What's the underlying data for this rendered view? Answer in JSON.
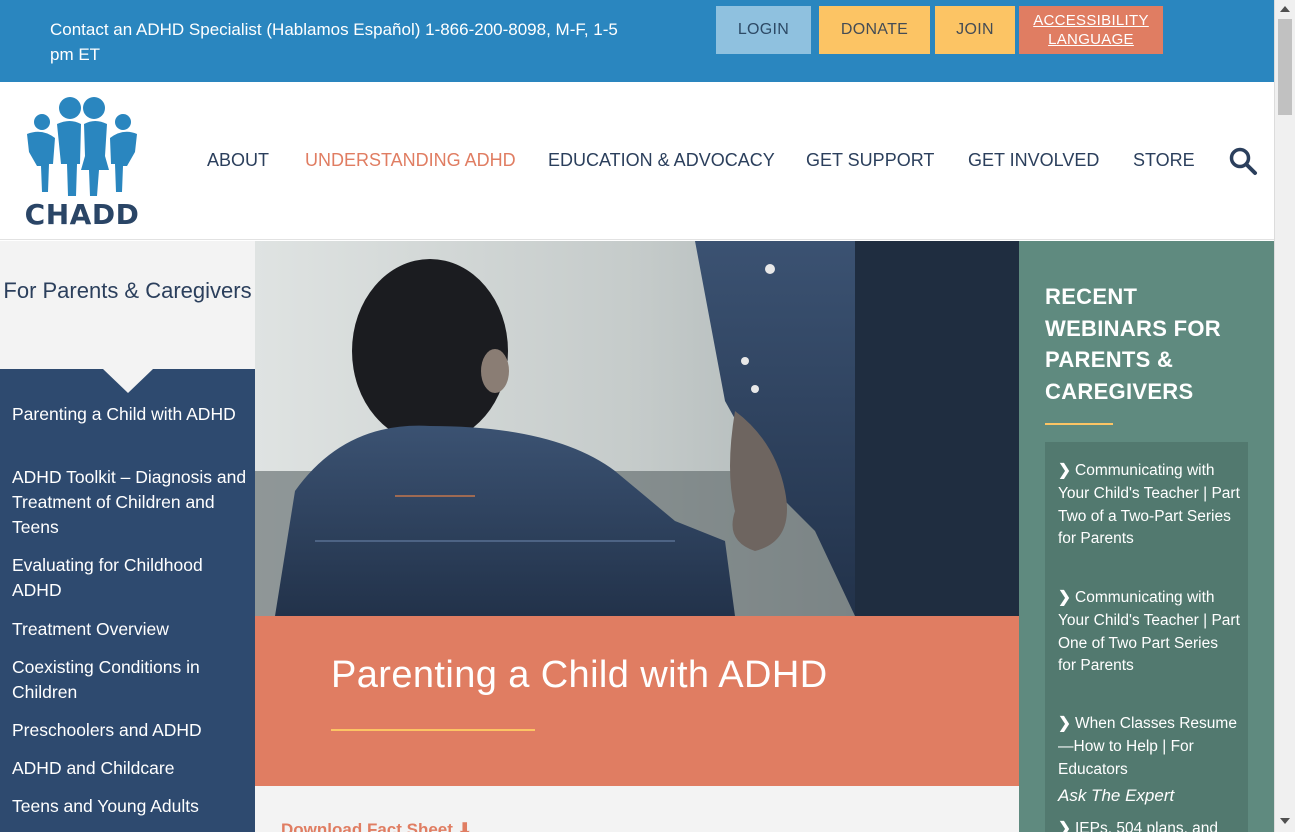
{
  "topbar": {
    "contact": "Contact an ADHD Specialist (Hablamos Español) 1-866-200-8098, M-F, 1-5 pm ET",
    "login": "LOGIN",
    "donate": "DONATE",
    "join": "JOIN",
    "accessibility": "ACCESSIBILITY",
    "language": "LANGUAGE"
  },
  "header": {
    "logo_text": "CHADD",
    "nav": [
      "ABOUT",
      "UNDERSTANDING ADHD",
      "EDUCATION & ADVOCACY",
      "GET SUPPORT",
      "GET INVOLVED",
      "STORE"
    ],
    "search_icon": "search-icon"
  },
  "sidebar": {
    "title": "For Parents & Caregivers",
    "items": [
      "Parenting a Child with ADHD",
      "ADHD Toolkit – Diagnosis and Treatment of Children and Teens",
      "Evaluating for Childhood ADHD",
      "Treatment Overview",
      "Coexisting Conditions in Children",
      "Preschoolers and ADHD",
      "ADHD and Childcare",
      "Teens and Young Adults"
    ]
  },
  "main": {
    "title": "Parenting a Child with ADHD",
    "download": "Download Fact Sheet"
  },
  "right": {
    "title": "RECENT WEBINARS FOR PARENTS & CAREGIVERS",
    "items": [
      "Communicating with Your Child's Teacher | Part Two of a Two-Part Series for Parents",
      "Communicating with Your Child's Teacher | Part One of Two Part Series for Parents",
      "When Classes Resume—How to Help | For Educators",
      "IEPs, 504 plans, and"
    ],
    "ask": "Ask The Expert"
  },
  "colors": {
    "topbar": "#2a86bf",
    "accent": "#e07d62",
    "navy": "#2e4a6f",
    "teal": "#5f8a7f",
    "gold": "#fcc464"
  }
}
